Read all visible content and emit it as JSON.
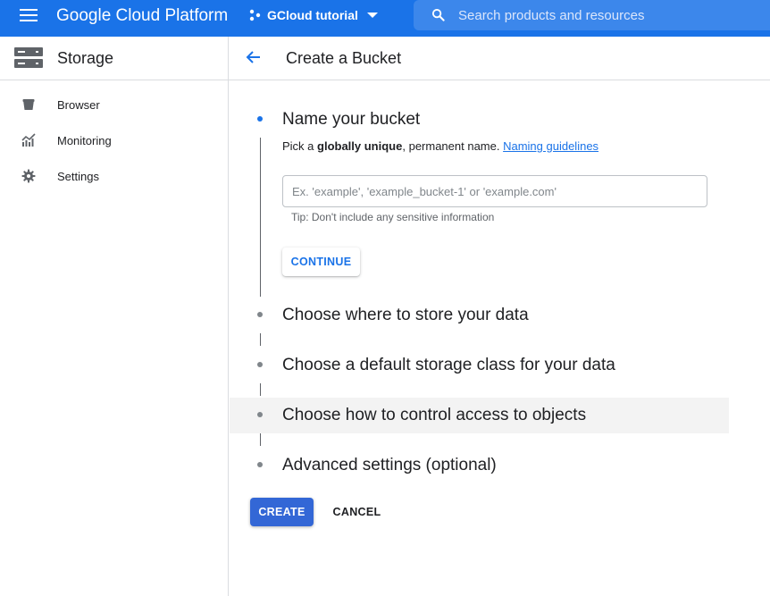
{
  "topbar": {
    "brand": "Google Cloud Platform",
    "project_name": "GCloud tutorial",
    "search_placeholder": "Search products and resources",
    "color": "#1a73e8"
  },
  "sidebar": {
    "title": "Storage",
    "items": [
      {
        "label": "Browser",
        "icon": "bucket-icon"
      },
      {
        "label": "Monitoring",
        "icon": "monitoring-chart-icon"
      },
      {
        "label": "Settings",
        "icon": "gear-icon"
      }
    ]
  },
  "main": {
    "title": "Create a Bucket",
    "steps": [
      {
        "title": "Name your bucket",
        "active": true
      },
      {
        "title": "Choose where to store your data",
        "active": false
      },
      {
        "title": "Choose a default storage class for your data",
        "active": false
      },
      {
        "title": "Choose how to control access to objects",
        "active": false
      },
      {
        "title": "Advanced settings (optional)",
        "active": false
      }
    ],
    "name_step": {
      "desc_prefix": "Pick a ",
      "desc_bold": "globally unique",
      "desc_suffix": ", permanent name. ",
      "guidelines_link": "Naming guidelines",
      "input_value": "",
      "input_placeholder": "Ex. 'example', 'example_bucket-1' or 'example.com'",
      "tip": "Tip: Don't include any sensitive information",
      "continue_label": "CONTINUE"
    },
    "create_label": "CREATE",
    "cancel_label": "CANCEL"
  },
  "colors": {
    "accent": "#1a73e8",
    "create_button": "#3367d6",
    "highlight_row": "#f3f3f3"
  }
}
